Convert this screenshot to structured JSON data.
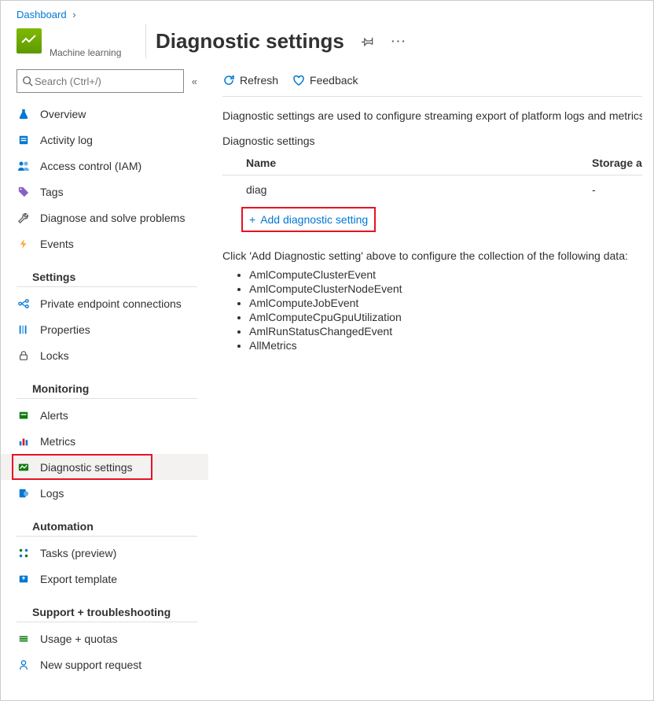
{
  "breadcrumb": {
    "dashboard": "Dashboard"
  },
  "header": {
    "resource_type": "Machine learning",
    "title": "Diagnostic settings"
  },
  "search": {
    "placeholder": "Search (Ctrl+/)"
  },
  "sidebar": {
    "items": {
      "overview": "Overview",
      "activity_log": "Activity log",
      "access_control": "Access control (IAM)",
      "tags": "Tags",
      "diagnose_solve": "Diagnose and solve problems",
      "events": "Events"
    },
    "sections": {
      "settings": {
        "label": "Settings",
        "items": {
          "private_endpoint": "Private endpoint connections",
          "properties": "Properties",
          "locks": "Locks"
        }
      },
      "monitoring": {
        "label": "Monitoring",
        "items": {
          "alerts": "Alerts",
          "metrics": "Metrics",
          "diagnostic_settings": "Diagnostic settings",
          "logs": "Logs"
        }
      },
      "automation": {
        "label": "Automation",
        "items": {
          "tasks": "Tasks (preview)",
          "export_template": "Export template"
        }
      },
      "support": {
        "label": "Support + troubleshooting",
        "items": {
          "usage_quotas": "Usage + quotas",
          "new_support": "New support request"
        }
      }
    }
  },
  "toolbar": {
    "refresh": "Refresh",
    "feedback": "Feedback"
  },
  "main": {
    "description": "Diagnostic settings are used to configure streaming export of platform logs and metrics for a r",
    "section_title": "Diagnostic settings",
    "table": {
      "headers": {
        "name": "Name",
        "storage": "Storage ac"
      },
      "rows": [
        {
          "name": "diag",
          "storage": "-"
        }
      ]
    },
    "add_link": "Add diagnostic setting",
    "hint": "Click 'Add Diagnostic setting' above to configure the collection of the following data:",
    "bullets": [
      "AmlComputeClusterEvent",
      "AmlComputeClusterNodeEvent",
      "AmlComputeJobEvent",
      "AmlComputeCpuGpuUtilization",
      "AmlRunStatusChangedEvent",
      "AllMetrics"
    ]
  }
}
